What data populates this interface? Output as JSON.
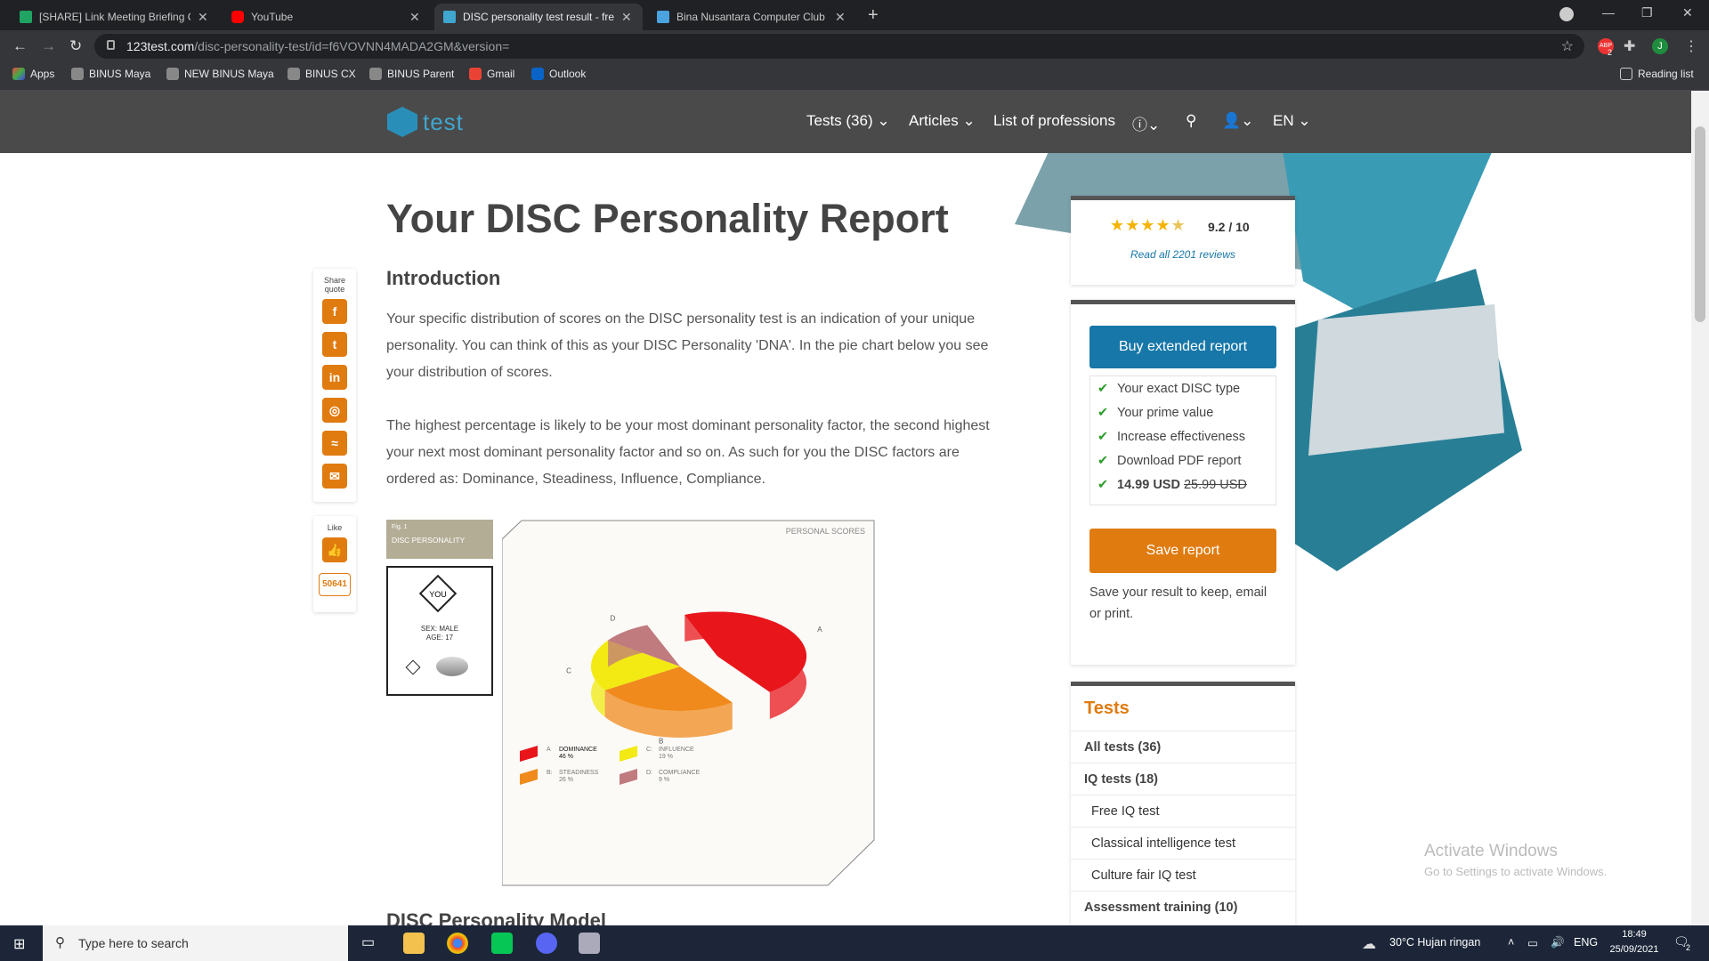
{
  "browser": {
    "tabs": [
      {
        "title": "[SHARE] Link Meeting Briefing C",
        "favicon": "sheets-icon",
        "active": false
      },
      {
        "title": "YouTube",
        "favicon": "youtube-icon",
        "active": false
      },
      {
        "title": "DISC personality test result - free",
        "favicon": "123test-icon",
        "active": true
      },
      {
        "title": "Bina Nusantara Computer Club -",
        "favicon": "page-icon",
        "active": false
      }
    ],
    "url_host": "123test.com",
    "url_path": "/disc-personality-test/id=f6VOVNN4MADA2GM&version=",
    "bookmarks": [
      "Apps",
      "BINUS Maya",
      "NEW BINUS Maya",
      "BINUS CX",
      "BINUS Parent",
      "Gmail",
      "Outlook"
    ],
    "reading_list": "Reading list",
    "profile_initial": "J",
    "abp_badge": "2"
  },
  "site": {
    "logo_text": "test",
    "nav": {
      "tests": "Tests (36)",
      "articles": "Articles",
      "professions": "List of professions",
      "lang": "EN"
    },
    "title": "Your DISC Personality Report",
    "intro_heading": "Introduction",
    "para1": "Your specific distribution of scores on the DISC personality test is an indication of your unique personality. You can think of this as your DISC Personality 'DNA'. In the pie chart below you see your distribution of scores.",
    "para2": "The highest percentage is likely to be your most dominant personality factor, the second highest your next most dominant personality factor and so on. As such for you the DISC factors are ordered as: Dominance, Steadiness, Influence, Compliance.",
    "next_heading": "DISC Personality Model",
    "share_label": "Share quote",
    "like_label": "Like",
    "like_count": "50641",
    "rating_value": "9.2 / 10",
    "rating_stars": 4.6,
    "rating_link": "Read all 2201 reviews",
    "buy_button": "Buy extended report",
    "features": [
      "Your exact DISC type",
      "Your prime value",
      "Increase effectiveness",
      "Download PDF report"
    ],
    "price": "14.99 USD",
    "old_price": "25.99 USD",
    "save_button": "Save report",
    "save_text": "Save your result to keep, email or print.",
    "tests_heading": "Tests",
    "tests_list": [
      "All tests (36)",
      "IQ tests (18)",
      "Free IQ test",
      "Classical intelligence test",
      "Culture fair IQ test",
      "Assessment training (10)"
    ]
  },
  "figure": {
    "fig_label": "Fig. 1",
    "fig_title": "DISC PERSONALITY",
    "you": "YOU",
    "sex": "SEX: MALE",
    "age": "AGE: 17",
    "header": "PERSONAL SCORES",
    "legend": [
      {
        "letter": "A",
        "name": "DOMINANCE",
        "pct": "46 %"
      },
      {
        "letter": "B:",
        "name": "STEADINESS",
        "pct": "26 %"
      },
      {
        "letter": "C:",
        "name": "INFLUENCE",
        "pct": "19 %"
      },
      {
        "letter": "D:",
        "name": "COMPLIANCE",
        "pct": "9 %"
      }
    ]
  },
  "chart_data": {
    "type": "pie",
    "title": "PERSONAL SCORES",
    "categories": [
      "A: Dominance",
      "B: Steadiness",
      "C: Influence",
      "D: Compliance"
    ],
    "values": [
      46,
      26,
      19,
      9
    ],
    "colors": [
      "#e8151b",
      "#f08a1c",
      "#f2ea12",
      "#c07b7e"
    ]
  },
  "watermark": {
    "line1": "Activate Windows",
    "line2": "Go to Settings to activate Windows."
  },
  "taskbar": {
    "search_placeholder": "Type here to search",
    "weather": "30°C  Hujan ringan",
    "lang": "ENG",
    "time": "18:49",
    "date": "25/09/2021",
    "notif": "2"
  }
}
